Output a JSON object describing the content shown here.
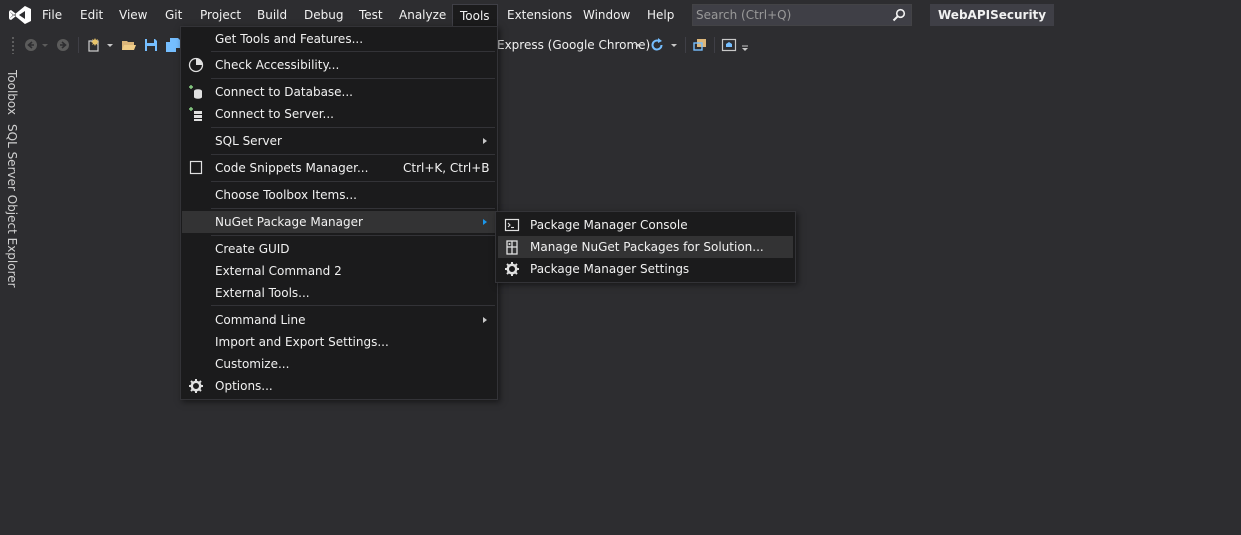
{
  "menubar": {
    "items": [
      "File",
      "Edit",
      "View",
      "Git",
      "Project",
      "Build",
      "Debug",
      "Test",
      "Analyze",
      "Tools",
      "Extensions",
      "Window",
      "Help"
    ],
    "active": "Tools"
  },
  "search": {
    "placeholder": "Search (Ctrl+Q)"
  },
  "solution_name": "WebAPISecurity",
  "toolbar": {
    "run_target": "Express (Google Chrome)"
  },
  "side_rail": {
    "tabs": [
      "Toolbox",
      "SQL Server Object Explorer"
    ]
  },
  "tools_menu": {
    "items": [
      {
        "label": "Get Tools and Features...",
        "icon": ""
      },
      {
        "label": "Check Accessibility...",
        "icon": "accessibility-icon"
      },
      {
        "label": "Connect to Database...",
        "icon": "database-connect-icon"
      },
      {
        "label": "Connect to Server...",
        "icon": "server-connect-icon"
      },
      {
        "label": "SQL Server",
        "has_submenu": true
      },
      {
        "label": "Code Snippets Manager...",
        "shortcut": "Ctrl+K, Ctrl+B",
        "icon": "snippet-icon"
      },
      {
        "label": "Choose Toolbox Items..."
      },
      {
        "label": "NuGet Package Manager",
        "has_submenu": true,
        "highlighted": true
      },
      {
        "label": "Create GUID"
      },
      {
        "label": "External Command 2"
      },
      {
        "label": "External Tools..."
      },
      {
        "label": "Command Line",
        "has_submenu": true
      },
      {
        "label": "Import and Export Settings..."
      },
      {
        "label": "Customize..."
      },
      {
        "label": "Options...",
        "icon": "gear-icon"
      }
    ]
  },
  "nuget_submenu": {
    "items": [
      {
        "label": "Package Manager Console",
        "icon": "console-icon"
      },
      {
        "label": "Manage NuGet Packages for Solution...",
        "icon": "package-icon",
        "highlighted": true
      },
      {
        "label": "Package Manager Settings",
        "icon": "gear-icon"
      }
    ]
  },
  "colors": {
    "background": "#2d2d30",
    "menu_bg": "#1b1b1c",
    "highlight": "#333334",
    "vs_purple": "#ffffff",
    "accent_blue": "#1c97ea"
  }
}
